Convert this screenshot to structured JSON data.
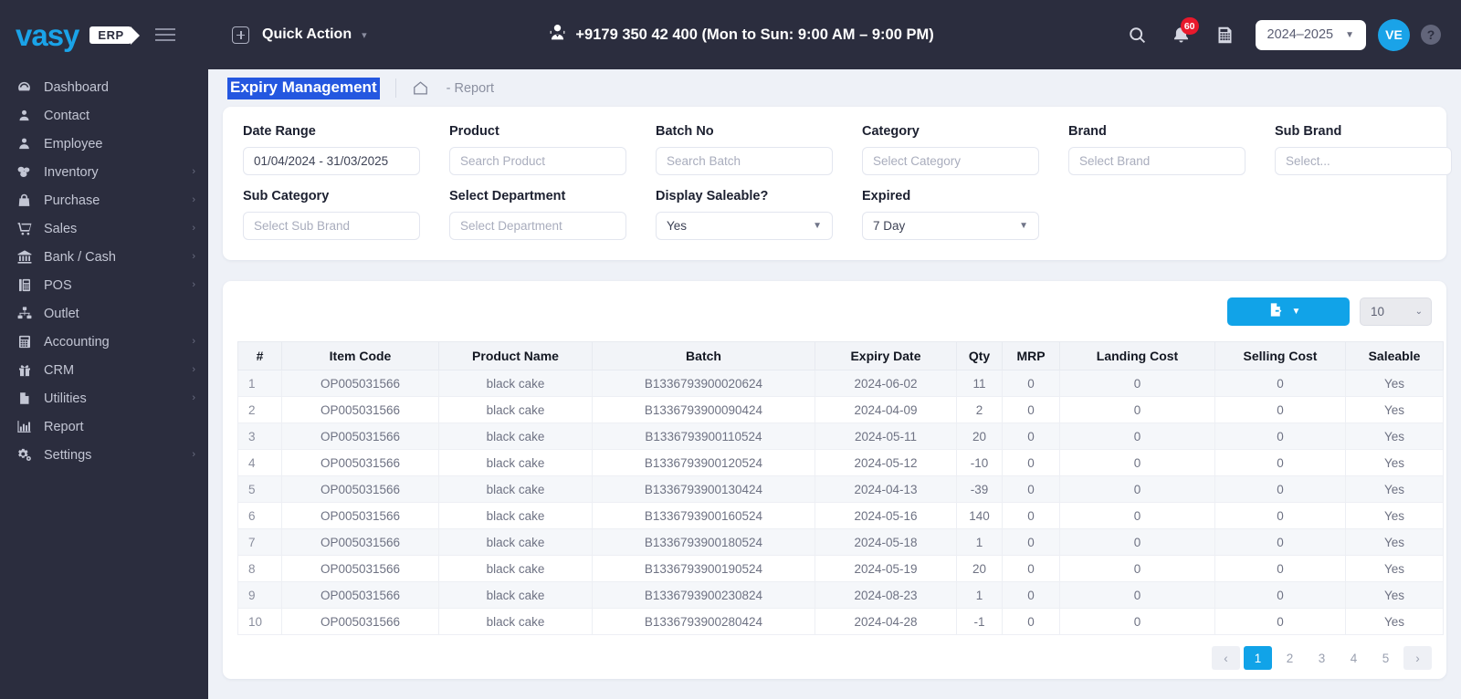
{
  "brand": {
    "name": "vasy",
    "suffix": "ERP"
  },
  "topbar": {
    "quick_action": "Quick Action",
    "phone": "+9179 350 42 400 (Mon to Sun: 9:00 AM – 9:00 PM)",
    "notification_badge": "60",
    "year": "2024–2025",
    "avatar_initials": "VE",
    "help": "?"
  },
  "sidebar": {
    "items": [
      {
        "label": "Dashboard",
        "icon": "dashboard-icon",
        "caret": false
      },
      {
        "label": "Contact",
        "icon": "contact-icon",
        "caret": false
      },
      {
        "label": "Employee",
        "icon": "employee-icon",
        "caret": false
      },
      {
        "label": "Inventory",
        "icon": "inventory-icon",
        "caret": true
      },
      {
        "label": "Purchase",
        "icon": "purchase-icon",
        "caret": true
      },
      {
        "label": "Sales",
        "icon": "sales-cart-icon",
        "caret": true
      },
      {
        "label": "Bank / Cash",
        "icon": "bank-icon",
        "caret": true
      },
      {
        "label": "POS",
        "icon": "pos-icon",
        "caret": true
      },
      {
        "label": "Outlet",
        "icon": "outlet-icon",
        "caret": false
      },
      {
        "label": "Accounting",
        "icon": "accounting-icon",
        "caret": true
      },
      {
        "label": "CRM",
        "icon": "crm-gift-icon",
        "caret": true
      },
      {
        "label": "Utilities",
        "icon": "utilities-file-icon",
        "caret": true
      },
      {
        "label": "Report",
        "icon": "report-chart-icon",
        "caret": false
      },
      {
        "label": "Settings",
        "icon": "settings-gear-icon",
        "caret": true
      }
    ]
  },
  "page": {
    "title": "Expiry Management",
    "breadcrumb_report": "- Report"
  },
  "filters": {
    "date_range": {
      "label": "Date Range",
      "value": "01/04/2024 - 31/03/2025"
    },
    "product": {
      "label": "Product",
      "placeholder": "Search Product"
    },
    "batch_no": {
      "label": "Batch No",
      "placeholder": "Search Batch"
    },
    "category": {
      "label": "Category",
      "placeholder": "Select Category"
    },
    "brand": {
      "label": "Brand",
      "placeholder": "Select Brand"
    },
    "sub_brand": {
      "label": "Sub Brand",
      "placeholder": "Select..."
    },
    "sub_category": {
      "label": "Sub Category",
      "placeholder": "Select Sub Brand"
    },
    "department": {
      "label": "Select Department",
      "placeholder": "Select Department"
    },
    "display_saleable": {
      "label": "Display Saleable?",
      "value": "Yes"
    },
    "expired": {
      "label": "Expired",
      "value": "7 Day"
    }
  },
  "toolbar": {
    "export_label": "",
    "page_length": "10"
  },
  "table": {
    "columns": [
      "#",
      "Item Code",
      "Product Name",
      "Batch",
      "Expiry Date",
      "Qty",
      "MRP",
      "Landing Cost",
      "Selling Cost",
      "Saleable"
    ],
    "rows": [
      [
        "1",
        "OP005031566",
        "black cake",
        "B1336793900020624",
        "2024-06-02",
        "11",
        "0",
        "0",
        "0",
        "Yes"
      ],
      [
        "2",
        "OP005031566",
        "black cake",
        "B1336793900090424",
        "2024-04-09",
        "2",
        "0",
        "0",
        "0",
        "Yes"
      ],
      [
        "3",
        "OP005031566",
        "black cake",
        "B1336793900110524",
        "2024-05-11",
        "20",
        "0",
        "0",
        "0",
        "Yes"
      ],
      [
        "4",
        "OP005031566",
        "black cake",
        "B1336793900120524",
        "2024-05-12",
        "-10",
        "0",
        "0",
        "0",
        "Yes"
      ],
      [
        "5",
        "OP005031566",
        "black cake",
        "B1336793900130424",
        "2024-04-13",
        "-39",
        "0",
        "0",
        "0",
        "Yes"
      ],
      [
        "6",
        "OP005031566",
        "black cake",
        "B1336793900160524",
        "2024-05-16",
        "140",
        "0",
        "0",
        "0",
        "Yes"
      ],
      [
        "7",
        "OP005031566",
        "black cake",
        "B1336793900180524",
        "2024-05-18",
        "1",
        "0",
        "0",
        "0",
        "Yes"
      ],
      [
        "8",
        "OP005031566",
        "black cake",
        "B1336793900190524",
        "2024-05-19",
        "20",
        "0",
        "0",
        "0",
        "Yes"
      ],
      [
        "9",
        "OP005031566",
        "black cake",
        "B1336793900230824",
        "2024-08-23",
        "1",
        "0",
        "0",
        "0",
        "Yes"
      ],
      [
        "10",
        "OP005031566",
        "black cake",
        "B1336793900280424",
        "2024-04-28",
        "-1",
        "0",
        "0",
        "0",
        "Yes"
      ]
    ]
  },
  "pagination": {
    "prev": "‹",
    "pages": [
      "1",
      "2",
      "3",
      "4",
      "5"
    ],
    "next": "›",
    "active": "1"
  },
  "colors": {
    "brand_blue": "#1aa3e8",
    "sidebar_bg": "#2b2d3e",
    "accent_button": "#11a3e8",
    "title_highlight": "#2457e0",
    "badge_red": "#e8192c"
  }
}
